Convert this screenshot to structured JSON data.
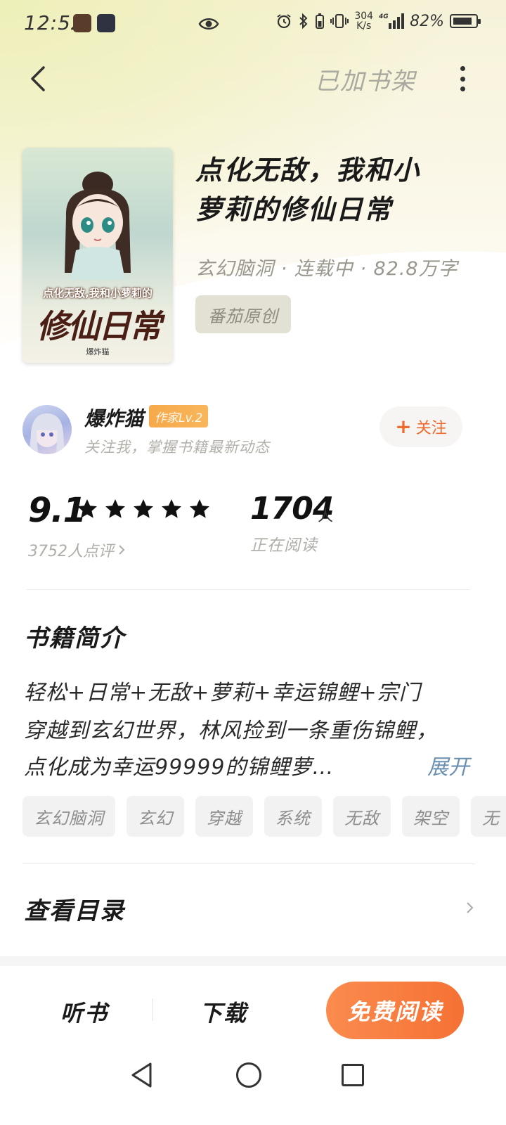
{
  "status_bar": {
    "time": "12:52",
    "net_speed_value": "304",
    "net_speed_unit": "K/s",
    "network": "4G",
    "battery": "82%"
  },
  "header": {
    "back_icon": "chevron-left-icon",
    "shelf_label": "已加书架",
    "more_icon": "more-vertical-icon"
  },
  "book": {
    "cover_title_small": "点化无敌,我和小萝莉的",
    "cover_title_big": "修仙日常",
    "cover_author": "爆炸猫",
    "title_line1": "点化无敌，我和小",
    "title_line2": "萝莉的修仙日常",
    "meta": "玄幻脑洞 · 连载中 · 82.8万字",
    "source_tag": "番茄原创"
  },
  "author": {
    "name": "爆炸猫",
    "level": "作家Lv.2",
    "desc": "关注我，掌握书籍最新动态",
    "follow_label": "关注"
  },
  "stats": {
    "rating": "9.1",
    "stars": 5,
    "rating_count": "3752人点评",
    "readers": "1704",
    "readers_unit": "人",
    "readers_label": "正在阅读"
  },
  "intro": {
    "title": "书籍简介",
    "line1": "轻松+日常+无敌+萝莉+幸运锦鲤+宗门",
    "line2": "穿越到玄幻世界，林风捡到一条重伤锦鲤，",
    "line3": "点化成为幸运99999的锦鲤萝…",
    "expand_label": "展开"
  },
  "tags": [
    "玄幻脑洞",
    "玄幻",
    "穿越",
    "系统",
    "无敌",
    "架空",
    "无"
  ],
  "catalog": {
    "title": "查看目录"
  },
  "bottom_bar": {
    "listen_label": "听书",
    "download_label": "下载",
    "read_label": "免费阅读"
  },
  "colors": {
    "accent": "#f57134",
    "level_badge": "#f6a94a",
    "link": "#6a8fb0"
  }
}
